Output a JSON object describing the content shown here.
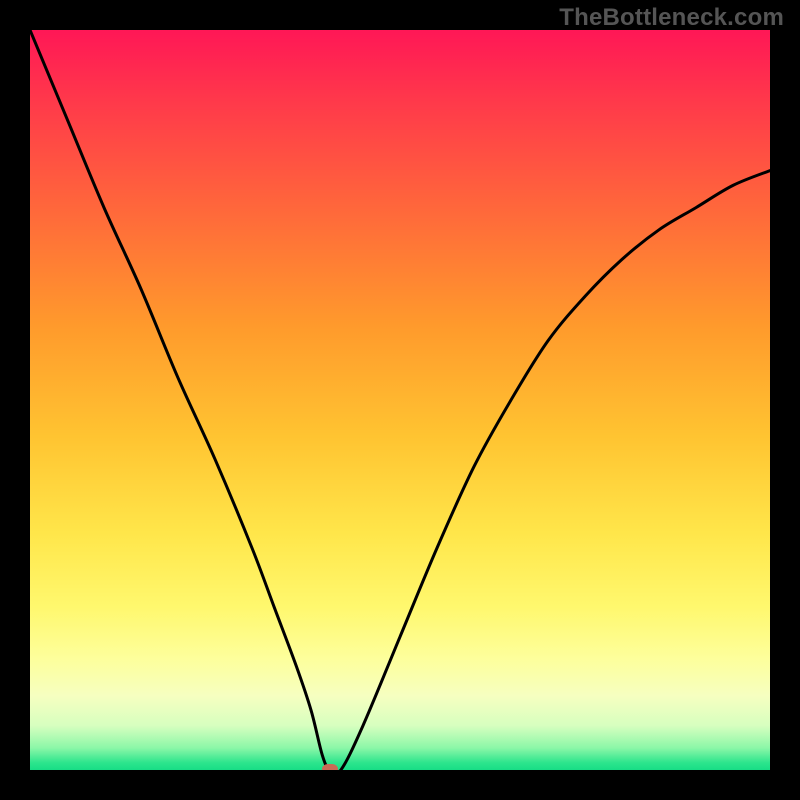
{
  "watermark": "TheBottleneck.com",
  "chart_data": {
    "type": "line",
    "title": "",
    "xlabel": "",
    "ylabel": "",
    "xlim": [
      0,
      100
    ],
    "ylim": [
      0,
      100
    ],
    "grid": false,
    "legend": false,
    "background": "rainbow-vertical-gradient",
    "series": [
      {
        "name": "curve",
        "x": [
          0,
          5,
          10,
          15,
          20,
          25,
          30,
          33,
          36,
          38,
          39.5,
          40.5,
          42,
          45,
          50,
          55,
          60,
          65,
          70,
          75,
          80,
          85,
          90,
          95,
          100
        ],
        "y": [
          100,
          88,
          76,
          65,
          53,
          42,
          30,
          22,
          14,
          8,
          2,
          0,
          0,
          6,
          18,
          30,
          41,
          50,
          58,
          64,
          69,
          73,
          76,
          79,
          81
        ]
      }
    ],
    "marker": {
      "x": 40.5,
      "y": 0,
      "color": "#c96b56"
    }
  },
  "colors": {
    "frame": "#000000",
    "watermark": "#555555",
    "curve": "#000000",
    "marker": "#c96b56"
  }
}
